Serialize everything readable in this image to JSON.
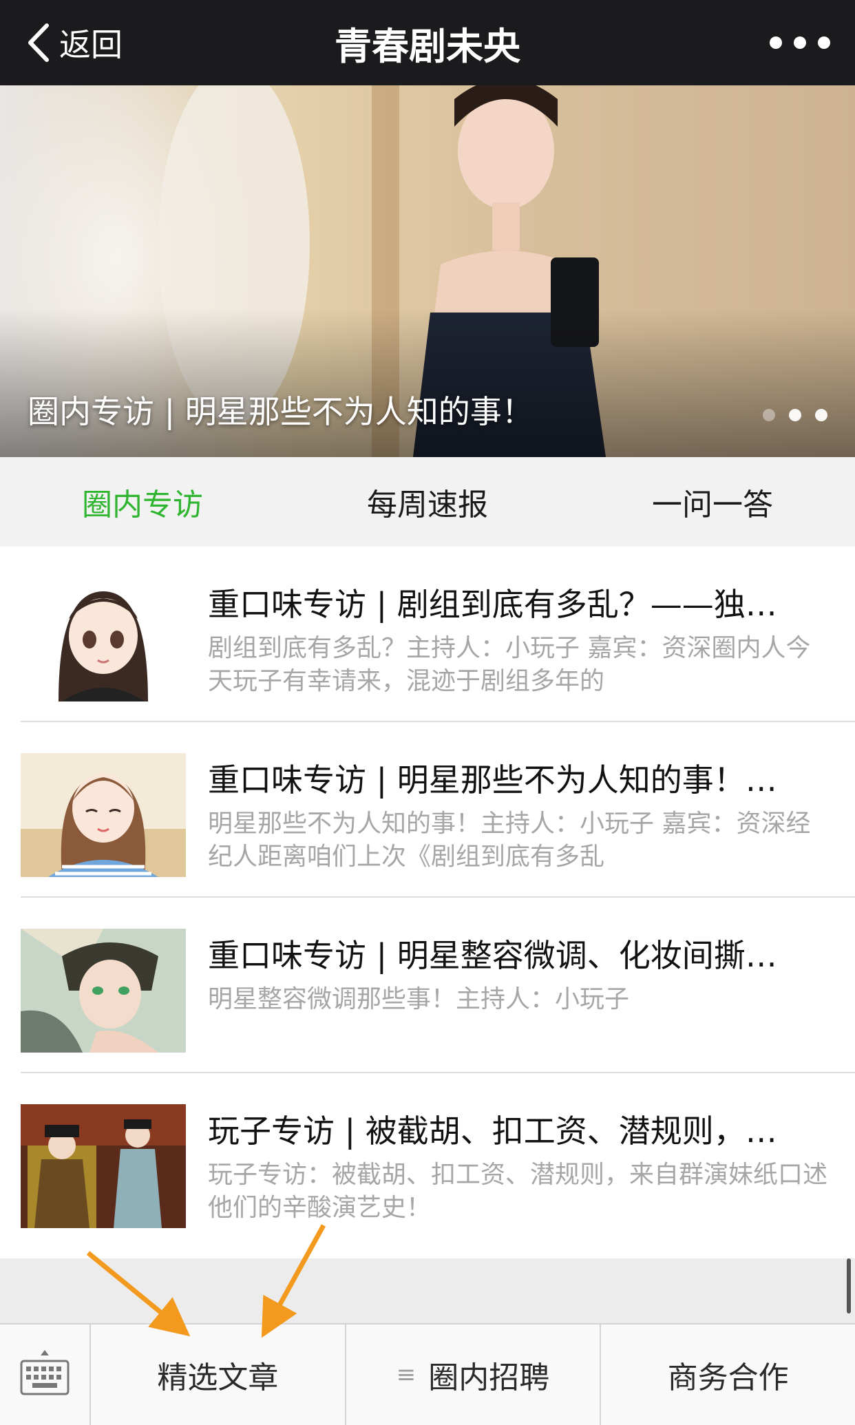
{
  "nav": {
    "back_label": "返回",
    "title": "青春剧未央",
    "back_icon": "chevron-left-icon",
    "more_icon": "more-dots-icon"
  },
  "banner": {
    "caption": "圈内专访 | 明星那些不为人知的事！",
    "slide_count": 3,
    "active_slide_index": 2
  },
  "tabs": [
    {
      "label": "圈内专访",
      "active": true
    },
    {
      "label": "每周速报",
      "active": false
    },
    {
      "label": "一问一答",
      "active": false
    }
  ],
  "articles": [
    {
      "title": "重口味专访 | 剧组到底有多乱？——独…",
      "desc": "剧组到底有多乱？主持人：小玩子 嘉宾：资深圈内人今天玩子有幸请来，混迹于剧组多年的"
    },
    {
      "title": "重口味专访 | 明星那些不为人知的事！…",
      "desc": "明星那些不为人知的事！主持人：小玩子 嘉宾：资深经纪人距离咱们上次《剧组到底有多乱"
    },
    {
      "title": "重口味专访 | 明星整容微调、化妆间撕…",
      "desc": "明星整容微调那些事！主持人：小玩子"
    },
    {
      "title": "玩子专访 | 被截胡、扣工资、潜规则，…",
      "desc": "玩子专访：被截胡、扣工资、潜规则，来自群演妹纸口述他们的辛酸演艺史！"
    }
  ],
  "bottom_menu": {
    "keyboard_icon": "keyboard-icon",
    "items": [
      {
        "label": "精选文章",
        "has_submenu": false
      },
      {
        "label": "圈内招聘",
        "has_submenu": true
      },
      {
        "label": "商务合作",
        "has_submenu": false
      }
    ],
    "submenu_icon": "menu-lines-icon"
  },
  "colors": {
    "nav_bg": "#1b1b1d",
    "active_tab": "#2fb52f",
    "annotation_arrow": "#f39a1e"
  }
}
